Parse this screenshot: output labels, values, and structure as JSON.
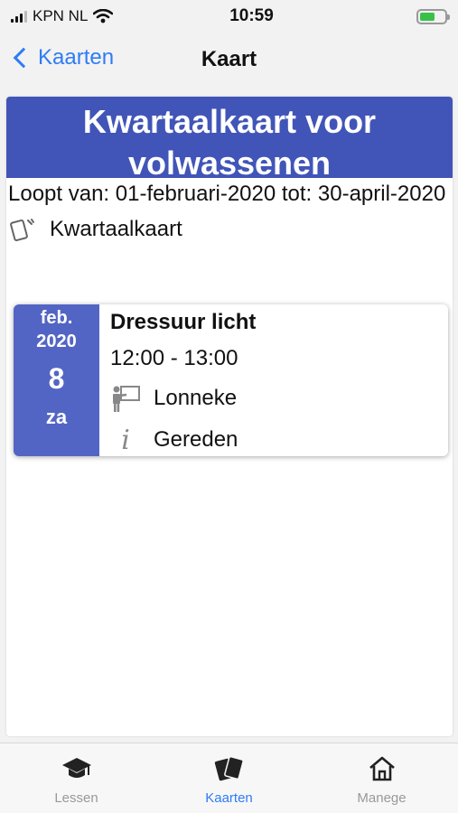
{
  "status_bar": {
    "carrier": "KPN NL",
    "time": "10:59"
  },
  "nav": {
    "back_label": "Kaarten",
    "title": "Kaart"
  },
  "card": {
    "title": "Kwartaalkaart voor volwassenen",
    "period": "Loopt van: 01-februari-2020 tot: 30-april-2020",
    "type": "Kwartaalkaart"
  },
  "lesson": {
    "month": "feb.",
    "year": "2020",
    "day": "8",
    "weekday": "za",
    "title": "Dressuur licht",
    "time": "12:00 - 13:00",
    "instructor": "Lonneke",
    "status": "Gereden"
  },
  "tabs": [
    {
      "label": "Lessen",
      "icon": "graduation-cap-icon"
    },
    {
      "label": "Kaarten",
      "icon": "cards-icon",
      "active": true
    },
    {
      "label": "Manege",
      "icon": "home-icon"
    }
  ],
  "colors": {
    "header": "#4155b8",
    "date_column": "#5365c4",
    "accent": "#2e7cf6"
  }
}
